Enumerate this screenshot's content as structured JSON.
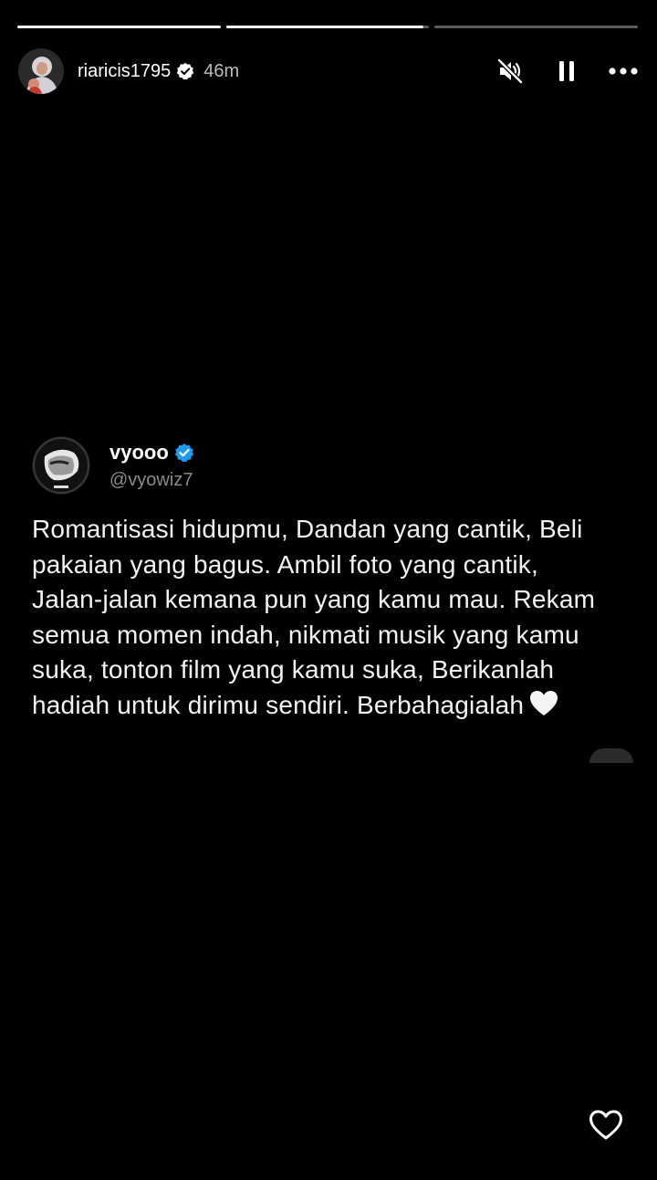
{
  "story": {
    "progress": {
      "segments_total": 3,
      "completed": 2,
      "current_fraction": 0.97
    },
    "header": {
      "username": "riaricis1795",
      "time": "46m",
      "verified_icon": "verified-badge-icon",
      "mute_icon": "speaker-muted-icon",
      "pause_icon": "pause-icon",
      "more_icon": "more-options-icon"
    },
    "tweet": {
      "display_name": "vyooo",
      "handle": "@vyowiz7",
      "verified_color": "#1d9bf0",
      "text": "Romantisasi hidupmu, Dandan yang cantik, Beli pakaian yang bagus. Ambil foto yang cantik, Jalan-jalan kemana pun yang kamu mau. Rekam semua momen indah, nikmati musik yang kamu suka, tonton film yang kamu suka, Berikanlah hadiah untuk dirimu sendiri. Berbahagialah",
      "emoji": "white-heart-icon"
    },
    "like_icon": "heart-outline-icon"
  }
}
